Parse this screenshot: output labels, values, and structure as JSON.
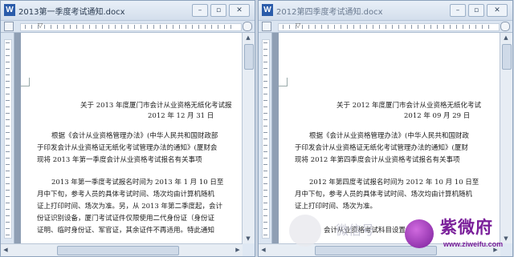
{
  "left_window": {
    "title": "2013第一季度考试通知.docx",
    "icon_letter": "W",
    "controls": {
      "minimize": "–",
      "restore": "▫",
      "close": "✕"
    },
    "lines": [
      "关于 2013 年度厦门市会计从业资格无纸化考试报",
      "2012 年 12 月 31 日",
      "根据《会计从业资格管理办法》(中华人民共和国财政部",
      "于印发会计从业资格证无纸化考试管理办法的通知》(厦财会",
      "现将 2013 年第一季度会计从业资格考试报名有关事项",
      "2013 年第一季度考试报名时间为 2013 年 1 月 10 日至",
      "月中下旬，参考人员的具体考试时间、场次均由计算机随机",
      "证上打印时间、场次为准。另，从 2013 年第二季度起，会计",
      "份证识别设备，厦门考试证件仅限使用二代身份证（身份证",
      "证明、临时身份证、军官证，其余证件不再适用。特此通知"
    ]
  },
  "right_window": {
    "title": "2012第四季度考试通知.docx",
    "icon_letter": "W",
    "controls": {
      "minimize": "–",
      "restore": "▫",
      "close": "✕"
    },
    "lines": [
      "关于 2012 年度厦门市会计从业资格无纸化考试",
      "2012 年 09 月 29 日",
      "根据《会计从业资格管理办法》(中华人民共和国财政",
      "于印发会计从业资格证无纸化考试管理办法的通知》(厦财",
      "现将 2012 年第四季度会计从业资格考试报名有关事项",
      "2012 年第四度考试报名时间为 2012 年 10 月 10 日至",
      "月中下旬，参考人员的具体考试时间、场次均由计算机随机",
      "证上打印时间、场次为准。",
      "会计从业资格考试科目设置"
    ]
  },
  "watermark": {
    "text": "微信号"
  },
  "logo": {
    "brand": "紫微府",
    "url": "www.ziweifu.com"
  },
  "scroll": {
    "up": "▲",
    "down": "▼",
    "left": "◀",
    "right": "▶"
  }
}
